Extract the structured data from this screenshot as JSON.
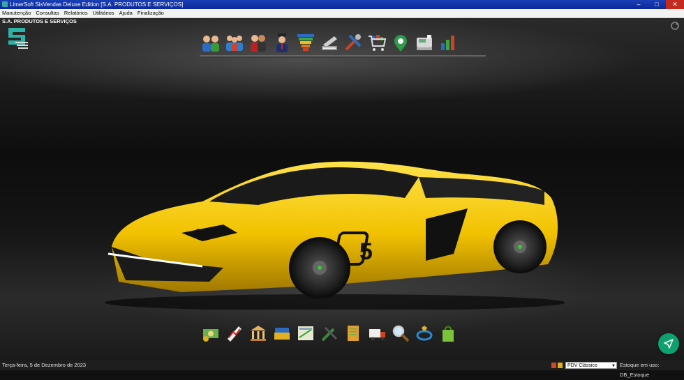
{
  "window": {
    "title": "LimerSoft SisVendas Deluxe Edition [S.A. PRODUTOS E SERVIÇOS]",
    "controls": [
      "–",
      "□",
      "✕"
    ]
  },
  "menu": {
    "items": [
      "Manutenção",
      "Consultas",
      "Relatórios",
      "Utilitários",
      "Ajuda",
      "Finalização"
    ]
  },
  "company_name": "S.A. PRODUTOS E SERVIÇOS",
  "top_toolbar": {
    "icons": [
      "clients-icon",
      "suppliers-icon",
      "users-icon",
      "salesman-icon",
      "funnel-icon",
      "scale-icon",
      "tools-icon",
      "shopping-cart-icon",
      "map-pin-icon",
      "cash-register-icon",
      "chart-icon"
    ]
  },
  "bottom_toolbar": {
    "icons": [
      "money-icon",
      "bill-chart-icon",
      "bank-icon",
      "wallet-icon",
      "calculator-icon",
      "edit-tools-icon",
      "document-icon",
      "truck-icon",
      "search-icon",
      "boat-icon",
      "shopping-bag-icon"
    ]
  },
  "car": {
    "body_color": "#f2c200",
    "number": "5"
  },
  "status": {
    "date": "Terça-feira, 5 de Dezembro de 2023",
    "pdv_selected": "PDV Clássico",
    "estoque": "Estoque em uso: DB_Estoque"
  },
  "colors": {
    "titlebar": "#0a2a9a",
    "accent_fab": "#0ea06f"
  }
}
